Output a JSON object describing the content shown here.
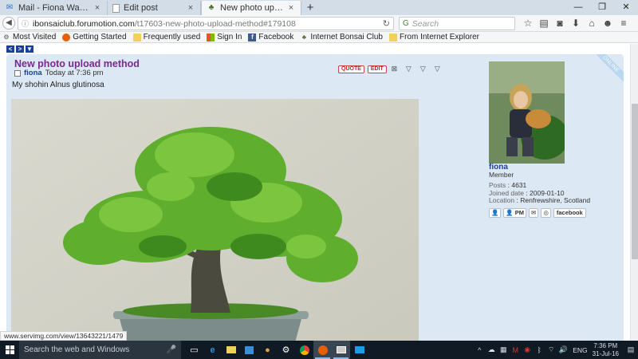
{
  "browser": {
    "tabs": [
      {
        "label": "Mail - Fiona Wallace - Out...",
        "icon": "mail-icon",
        "active": false
      },
      {
        "label": "Edit post",
        "icon": "page-icon",
        "active": false
      },
      {
        "label": "New photo upload method",
        "icon": "tree-icon",
        "active": true
      }
    ],
    "url_host": "ibonsaiclub.forumotion.com",
    "url_path": "/t17603-new-photo-upload-method#179108",
    "search_placeholder": "Search",
    "bookmarks": [
      {
        "label": "Most Visited",
        "icon": "gear-icon"
      },
      {
        "label": "Getting Started",
        "icon": "firefox-icon"
      },
      {
        "label": "Frequently used",
        "icon": "folder-icon"
      },
      {
        "label": "Sign In",
        "icon": "windows-icon"
      },
      {
        "label": "Facebook",
        "icon": "facebook-icon"
      },
      {
        "label": "Internet Bonsai Club",
        "icon": "tree-icon"
      },
      {
        "label": "From Internet Explorer",
        "icon": "folder-icon"
      }
    ],
    "status_link": "www.servimg.com/view/13643221/1479"
  },
  "post": {
    "title": "New photo upload method",
    "author": "fiona",
    "timestamp": "Today at 7:36 pm",
    "text": "My shohin Alnus glutinosa",
    "actions": {
      "quote": "QUOTE",
      "edit": "EDIT"
    }
  },
  "profile": {
    "name": "fiona",
    "rank": "Member",
    "online_badge": "ONLINE",
    "posts_label": "Posts",
    "posts": "4631",
    "joined_label": "Joined date",
    "joined": "2009-01-10",
    "location_label": "Location",
    "location": "Renfrewshire, Scotland",
    "pm_label": "PM",
    "facebook_label": "facebook"
  },
  "taskbar": {
    "search_placeholder": "Search the web and Windows",
    "language": "ENG",
    "time": "7:36 PM",
    "date": "31-Jul-16"
  },
  "colors": {
    "post_bg": "#dce8f3",
    "title_purple": "#7a2a8f",
    "link_blue": "#1a3f9c"
  }
}
